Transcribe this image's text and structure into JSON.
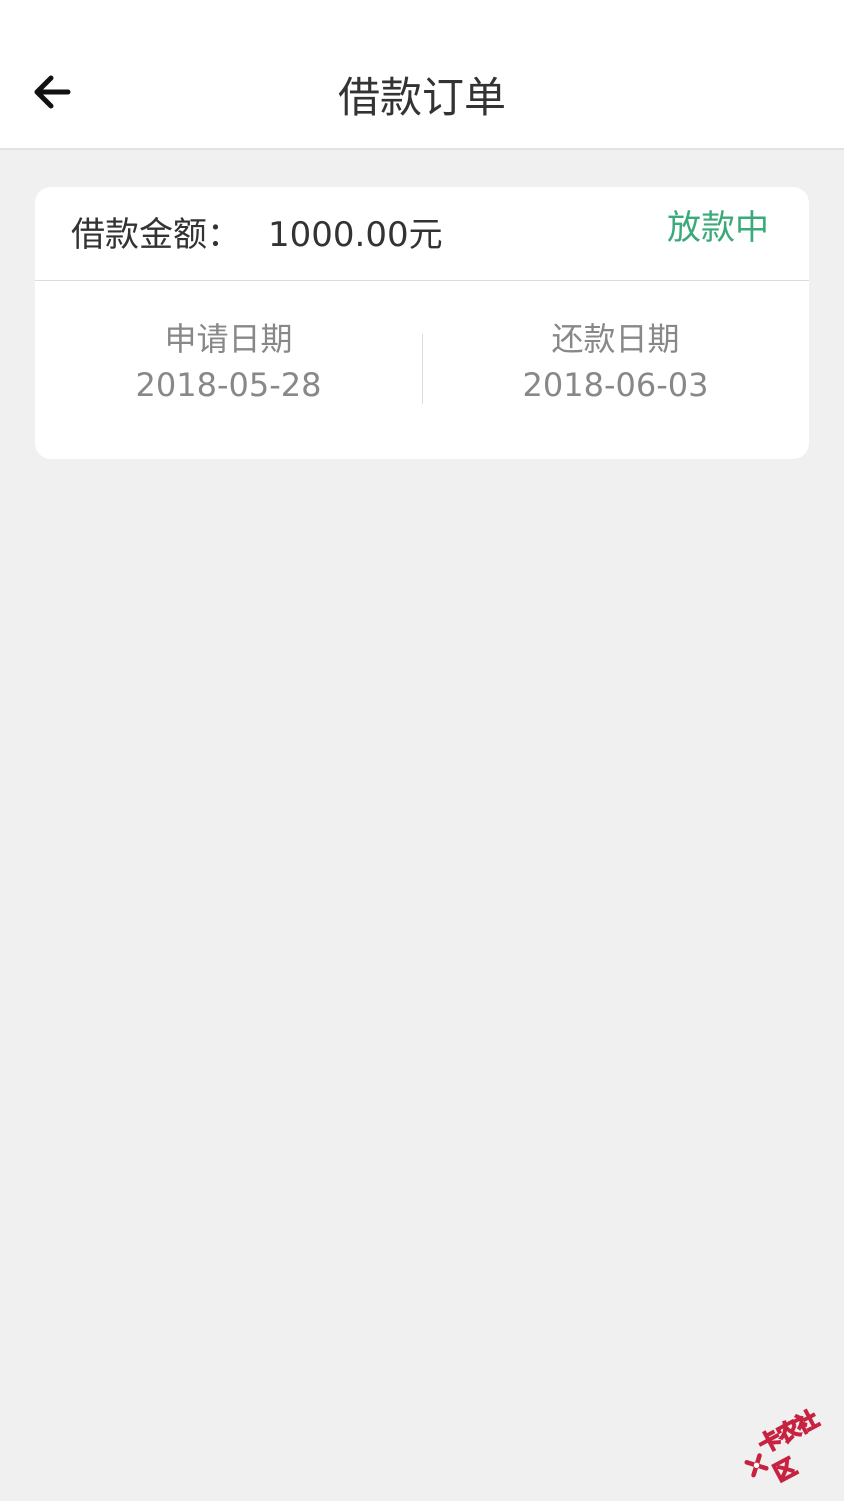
{
  "header": {
    "title": "借款订单",
    "back_icon": "arrow-left-icon"
  },
  "order": {
    "amount_label": "借款金额：",
    "amount_value": "1000.00元",
    "status": "放款中",
    "status_color": "#3aaa78",
    "apply_date_label": "申请日期",
    "apply_date": "2018-05-28",
    "repay_date_label": "还款日期",
    "repay_date": "2018-06-03"
  },
  "watermark": {
    "text": "卡农社区",
    "logo_icon": "kanong-logo-icon",
    "color": "#c7223f"
  }
}
